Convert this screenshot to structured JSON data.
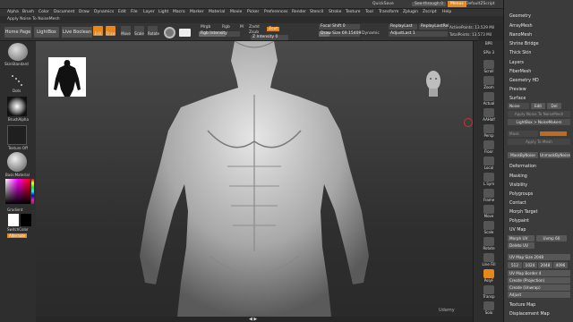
{
  "titlebar": {
    "quicksave": "QuickSave",
    "see_through": "See-through  0",
    "menus": "Menus",
    "script": "DefaultZScript"
  },
  "menubar": {
    "items": [
      "Alpha",
      "Brush",
      "Color",
      "Document",
      "Draw",
      "Dynamics",
      "Edit",
      "File",
      "Layer",
      "Light",
      "Macro",
      "Marker",
      "Material",
      "Movie",
      "Picker",
      "Preferences",
      "Render",
      "Stencil",
      "Stroke",
      "Texture",
      "Tool",
      "Transform",
      "Zplugin",
      "Zscript",
      "Help"
    ]
  },
  "notebar": {
    "text": "Apply Noise To NoiseMesh"
  },
  "toolbar": {
    "home": "Home Page",
    "lightbox": "LightBox",
    "live_boolean": "Live Boolean",
    "edit": "Edit",
    "draw": "Draw",
    "move": "Move",
    "scale": "Scale",
    "rotate": "Rotate",
    "mrgb": "Mrgb",
    "rgb": "Rgb",
    "m": "M",
    "zadd": "Zadd",
    "zsub": "Zsub",
    "zcut": "Zcut",
    "rgb_intensity": "Rgb Intensity",
    "z_intensity": "Z Intensity 0",
    "focal_shift": "Focal Shift 0",
    "draw_size": "Draw Size 69.15409",
    "dynamic": "Dynamic",
    "replay_last": "ReplayLast",
    "replay_last_rel": "ReplayLastRel",
    "adjust_last": "AdjustLast 1",
    "active_points": "ActivePoints: 13.529 Mil",
    "total_points": "TotalPoints: 13.573 Mil"
  },
  "leftshelf": {
    "brush_name": "SkinStandard",
    "dots": "Dots",
    "alpha": "BrushAlpha",
    "texture": "Texture Off",
    "material": "BasicMaterial",
    "gradient": "Gradient",
    "switch_color": "SwitchColor",
    "alternate": "Alternate"
  },
  "rightshelf": {
    "items": [
      "BPR",
      "SPix 3",
      "Scroll",
      "Zoom",
      "Actual",
      "AAHalf",
      "Persp",
      "Floor",
      "Local",
      "L.Sym",
      "Frame",
      "Move",
      "Scale",
      "Rotate",
      "Line Fill",
      "PolyF",
      "Transp",
      "Ghost",
      "Solo",
      "Xpose"
    ]
  },
  "tray": {
    "items_top": [
      "Geometry",
      "ArrayMesh",
      "NanoMesh",
      "Shrine Bridge",
      "Thick Skin",
      "Layers",
      "FiberMesh",
      "Geometry HD",
      "Preview",
      "Surface"
    ],
    "noise": "Noise",
    "edit": "Edit",
    "del": "Del",
    "apply_noise_mesh": "Apply Noise To NoiseMesh",
    "lightbox_noisemakers": "LightBox > NoiseMakers",
    "mask": "Mask",
    "apply_to_mesh": "Apply To Mesh",
    "mask_by_noise": "MaskByNoise",
    "unmask_by_noise": "UnmaskByNoise",
    "items_mid": [
      "Deformation",
      "Masking",
      "Visibility",
      "Polygroups",
      "Contact",
      "Morph Target",
      "Polypaint"
    ],
    "uv_map": "UV Map",
    "morph_uv": "Morph UV",
    "uv_value": "Uvmp 60",
    "delete_uv": "Delete UV",
    "uv_map_size": "UV Map Size 2048",
    "sizes": [
      "512",
      "1024",
      "2048",
      "4096"
    ],
    "uv_map_border": "UV Map Border 4",
    "create_projection": "Create (Projection)",
    "create_unwrap": "Create (Unwrap)",
    "adjust": "Adjust",
    "texture_map": "Texture Map",
    "displacement_map": "Displacement Map"
  },
  "watermark": "Udemy",
  "colors": {
    "accent": "#e8881a",
    "bg": "#2a2a2a",
    "tray": "#3b3b3b"
  }
}
